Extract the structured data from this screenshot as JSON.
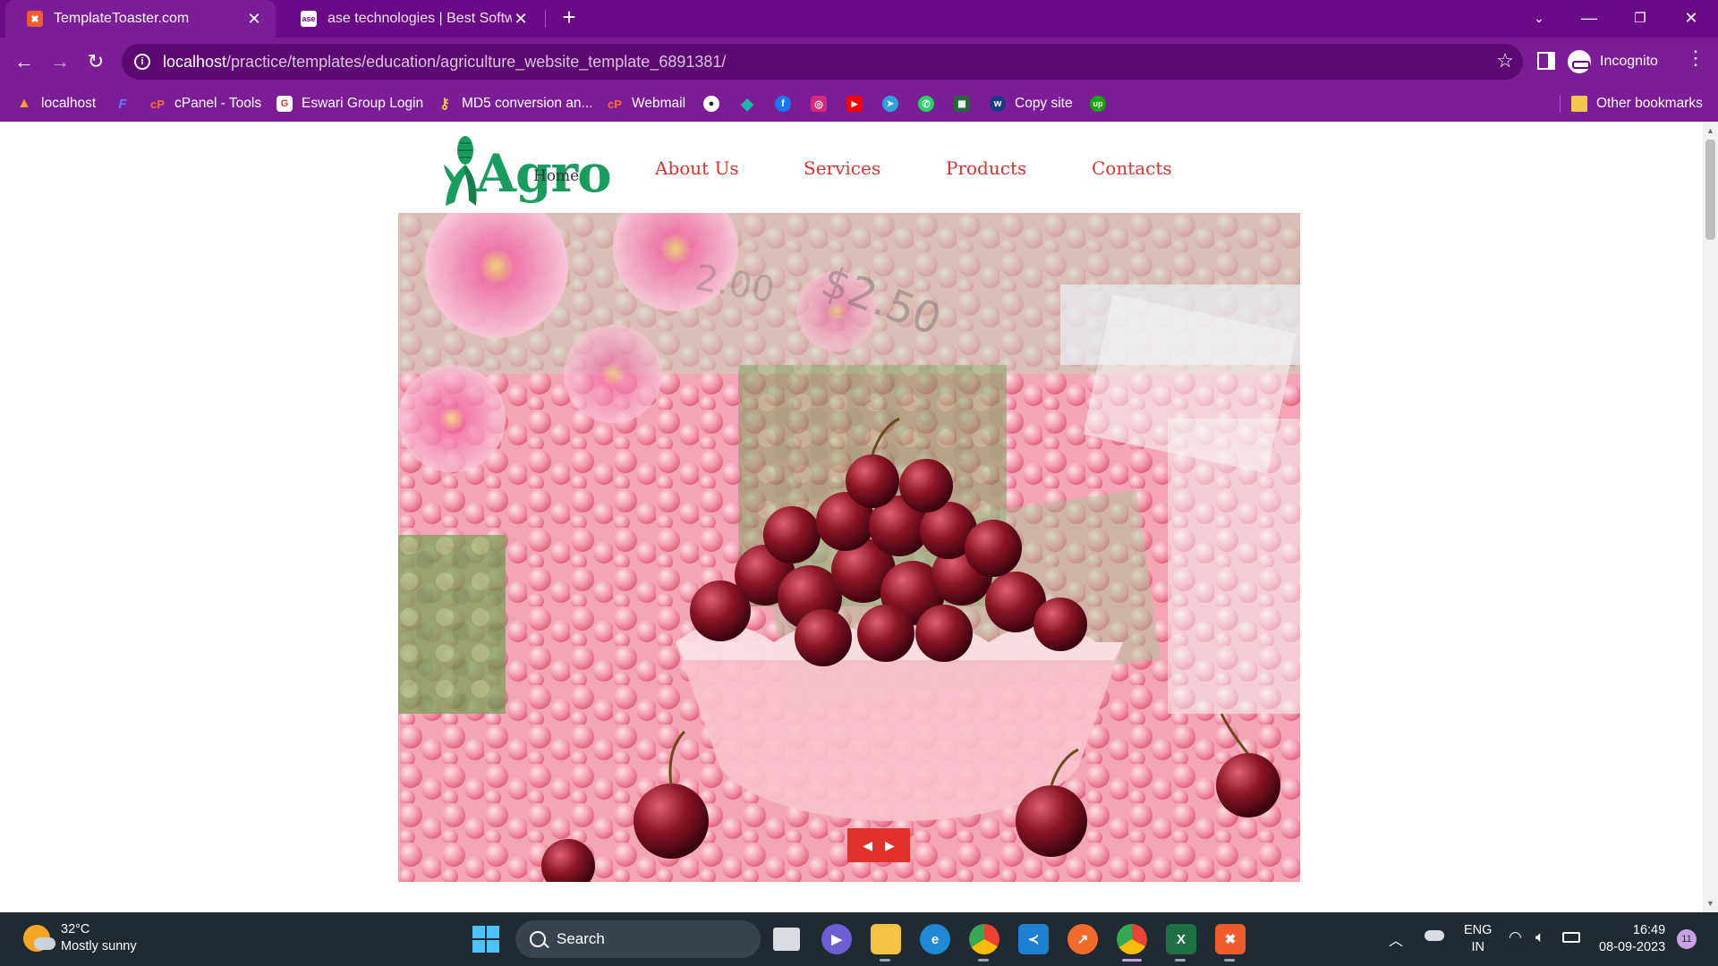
{
  "browser": {
    "tabs": [
      {
        "title": "TemplateToaster.com",
        "active": true,
        "favicon": "templatetoaster-icon"
      },
      {
        "title": "ase technologies | Best Software",
        "active": false,
        "favicon": "ase-icon"
      }
    ],
    "address_bar": {
      "host": "localhost",
      "path": "/practice/templates/education/agriculture_website_template_6891381/"
    },
    "profile_label": "Incognito",
    "bookmarks": [
      {
        "label": "localhost",
        "icon": "xampp-icon"
      },
      {
        "label": "",
        "icon": "f-icon"
      },
      {
        "label": "cPanel - Tools",
        "icon": "cpanel-icon"
      },
      {
        "label": "Eswari Group Login",
        "icon": "g-icon"
      },
      {
        "label": "MD5 conversion an...",
        "icon": "key-icon"
      },
      {
        "label": "Webmail",
        "icon": "cpanel-icon"
      },
      {
        "label": "",
        "icon": "github-icon"
      },
      {
        "label": "",
        "icon": "diamond-icon"
      },
      {
        "label": "",
        "icon": "facebook-icon"
      },
      {
        "label": "",
        "icon": "instagram-icon"
      },
      {
        "label": "",
        "icon": "youtube-icon"
      },
      {
        "label": "",
        "icon": "telegram-icon"
      },
      {
        "label": "",
        "icon": "whatsapp-icon"
      },
      {
        "label": "",
        "icon": "sheet-icon"
      },
      {
        "label": "Copy site",
        "icon": "w-icon"
      },
      {
        "label": "",
        "icon": "upwork-icon"
      }
    ],
    "other_bookmarks": "Other bookmarks"
  },
  "site": {
    "logo_text": "Agro",
    "logo_overlap_text": "Home",
    "nav": [
      "About Us",
      "Services",
      "Products",
      "Contacts"
    ],
    "slider": {
      "image": "cherries-tomatoes-market-collage",
      "prev_glyph": "◀",
      "next_glyph": "▶"
    }
  },
  "taskbar": {
    "weather": {
      "temp": "32°C",
      "condition": "Mostly sunny"
    },
    "search_placeholder": "Search",
    "language": {
      "line1": "ENG",
      "line2": "IN"
    },
    "clock": {
      "time": "16:49",
      "date": "08-09-2023"
    },
    "notification_count": "11"
  },
  "colors": {
    "browser_frame": "#7d1c97",
    "tab_strip": "#6a0a86",
    "nav_link": "#d8342d",
    "logo_green": "#1a9c5e",
    "slider_control": "#e2312b",
    "taskbar": "#202a33"
  }
}
